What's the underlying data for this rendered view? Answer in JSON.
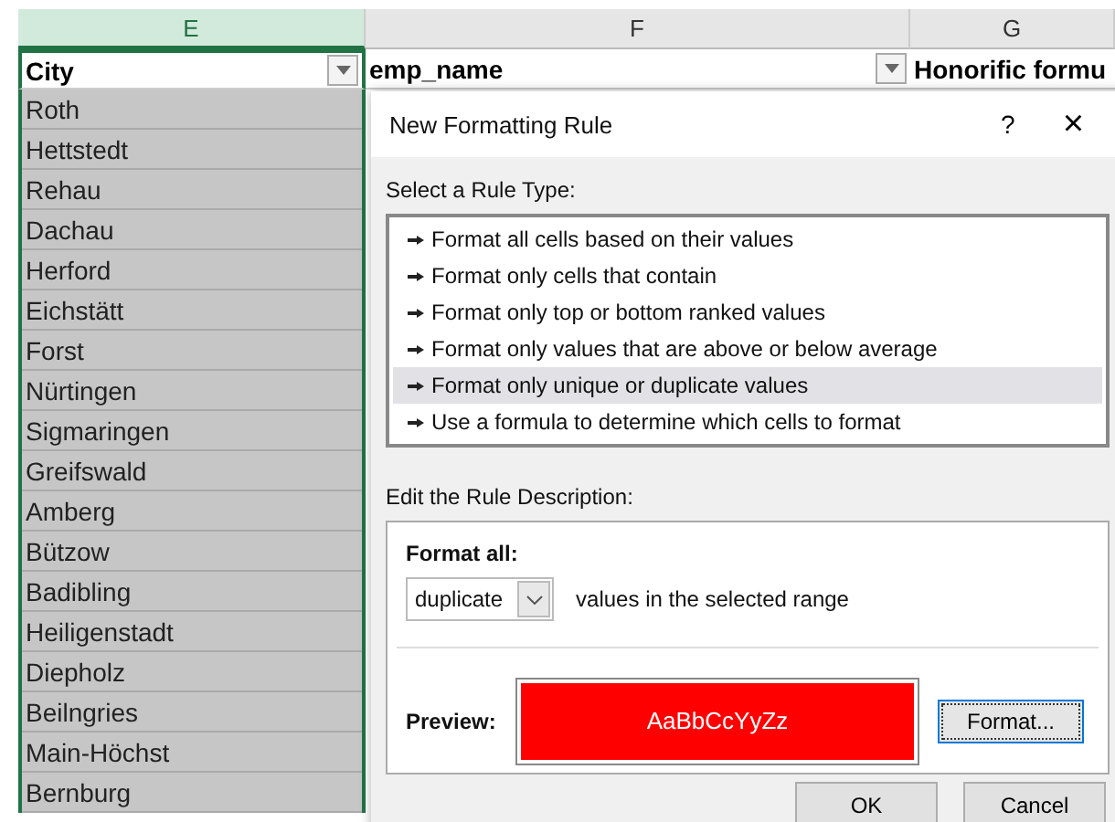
{
  "sheet": {
    "column_headers": [
      {
        "label": "E",
        "selected": true
      },
      {
        "label": "F",
        "selected": false
      },
      {
        "label": "G",
        "selected": false
      }
    ],
    "fields": [
      "City",
      "emp_name",
      "Honorific formu"
    ],
    "rows": [
      "Roth",
      "Hettstedt",
      "Rehau",
      "Dachau",
      "Herford",
      "Eichstätt",
      "Forst",
      "Nürtingen",
      "Sigmaringen",
      "Greifswald",
      "Amberg",
      "Bützow",
      "Badibling",
      "Heiligenstadt",
      "Diepholz",
      "Beilngries",
      "Main-Höchst",
      "Bernburg"
    ]
  },
  "dialog": {
    "title": "New Formatting Rule",
    "help": "?",
    "close": "×",
    "rule_type_label": "Select a Rule Type:",
    "rule_types": [
      {
        "label": "Format all cells based on their values",
        "selected": false
      },
      {
        "label": "Format only cells that contain",
        "selected": false
      },
      {
        "label": "Format only top or bottom ranked values",
        "selected": false
      },
      {
        "label": "Format only values that are above or below average",
        "selected": false
      },
      {
        "label": "Format only unique or duplicate values",
        "selected": true
      },
      {
        "label": "Use a formula to determine which cells to format",
        "selected": false
      }
    ],
    "description_label": "Edit the Rule Description:",
    "format_all_label": "Format all:",
    "dropdown": {
      "value": "duplicate"
    },
    "dropdown_suffix": "values in the selected range",
    "preview_label": "Preview:",
    "preview_sample": "AaBbCcYyZz",
    "format_button": "Format...",
    "buttons": [
      "OK",
      "Cancel"
    ]
  }
}
